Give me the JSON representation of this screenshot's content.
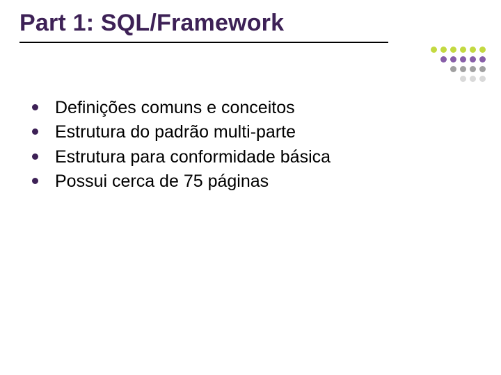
{
  "title": "Part 1: SQL/Framework",
  "bullets": [
    "Definições comuns e conceitos",
    "Estrutura do padrão multi-parte",
    "Estrutura para conformidade básica",
    "Possui cerca de 75 páginas"
  ],
  "decor": {
    "rows": [
      [
        "#c3d941",
        "#c3d941",
        "#c3d941",
        "#c3d941",
        "#c3d941",
        "#c3d941"
      ],
      [
        "#875ea8",
        "#875ea8",
        "#875ea8",
        "#875ea8",
        "#875ea8"
      ],
      [
        "#a0a0a0",
        "#a0a0a0",
        "#a0a0a0",
        "#a0a0a0"
      ],
      [
        "#d9d9d9",
        "#d9d9d9",
        "#d9d9d9"
      ]
    ]
  }
}
